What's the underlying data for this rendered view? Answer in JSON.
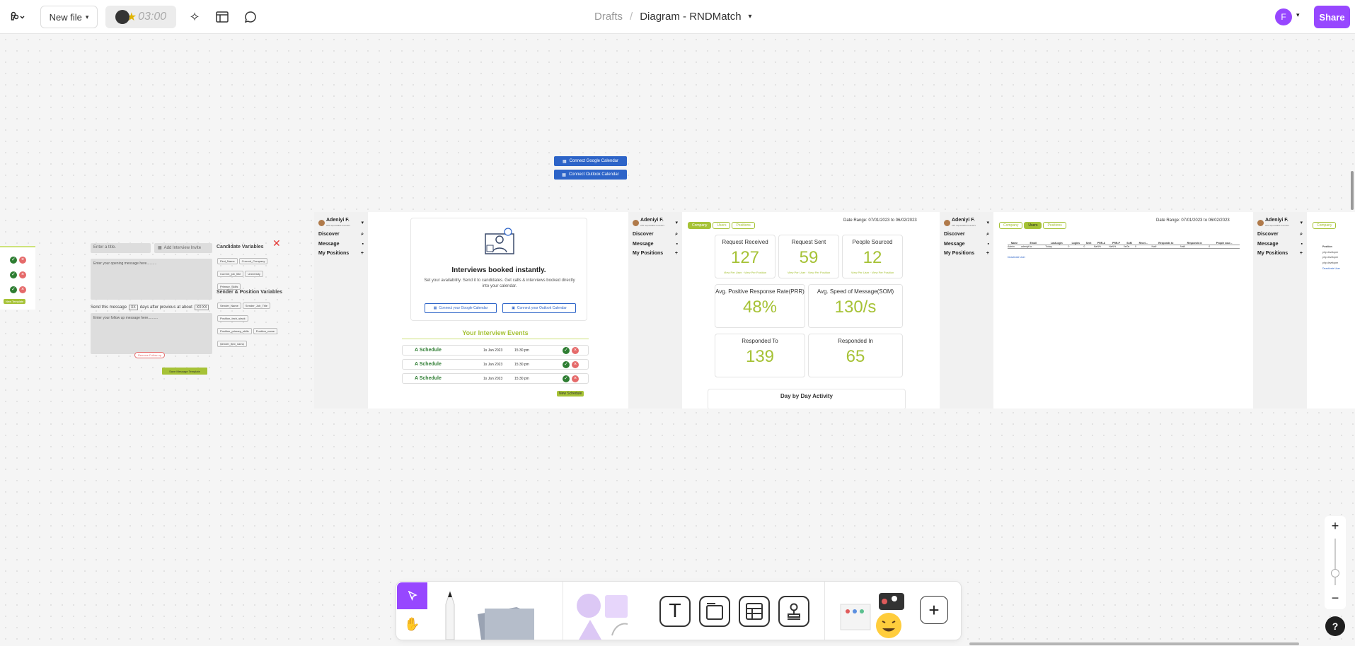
{
  "topbar": {
    "new_file_label": "New file",
    "timer": "03:00",
    "breadcrumb_parent": "Drafts",
    "breadcrumb_sep": "/",
    "file_name": "Diagram - RNDMatch",
    "avatar_initial": "F",
    "share_label": "Share"
  },
  "calendar_buttons": {
    "google": "Connect Google Calendar",
    "outlook": "Connect Outlook Calendar"
  },
  "left_strip": {
    "new_template": "New Template"
  },
  "template_editor": {
    "title_placeholder": "Enter a title.",
    "interview_invite": "Add Interview Invite",
    "opening_placeholder": "Enter your opening message here..........",
    "send_message_prefix": "Send this message",
    "days_value": "XX",
    "days_suffix": "days after previous at about",
    "time_value": "XX:XX",
    "followup_placeholder": "Enter your follow up message here..........",
    "remove_followup": "Remove Follow up",
    "save_template": "Save Message Template",
    "candidate_vars_title": "Candidate Variables",
    "candidate_vars": [
      "First_Name",
      "Current_Company",
      "Current_job_title",
      "University",
      "Primary_Skills"
    ],
    "sender_vars_title": "Sender & Position Variables",
    "sender_vars": [
      "Sender_Name",
      "Sender_Job_Title",
      "Position_tech_stack",
      "Position_primary_skills",
      "Position_name",
      "Sender_first_name"
    ]
  },
  "sidebar": {
    "user_name": "Adeniyi F.",
    "user_sub": "225 requestable founders",
    "items": [
      "Discover",
      "Message",
      "My Positions"
    ]
  },
  "interviews": {
    "headline": "Interviews booked instantly.",
    "subtext": "Set your availability. Send it to candidates. Get calls & interviews booked directly into your calendar.",
    "connect_google": "Connect your Google Calendar",
    "connect_outlook": "Connect your Outlook Calendar",
    "events_title": "Your Interview Events",
    "events": [
      {
        "name": "A Schedule",
        "date": "1s Jan 2023",
        "time": "15:30 pm"
      },
      {
        "name": "A Schedule",
        "date": "1s Jan 2023",
        "time": "15:30 pm"
      },
      {
        "name": "A Schedule",
        "date": "1s Jan 2023",
        "time": "15:30 pm"
      }
    ],
    "new_schedule": "New Schedule"
  },
  "dashboard": {
    "tabs": [
      "Company",
      "Users",
      "Positions"
    ],
    "date_range": "Date Range: 07/01/2023  to  06/02/2023",
    "metrics": [
      {
        "label": "Request Received",
        "value": "127",
        "link_a": "View Per User",
        "link_b": "View Per Position"
      },
      {
        "label": "Request Sent",
        "value": "59",
        "link_a": "View Per User",
        "link_b": "View Per Position"
      },
      {
        "label": "People Sourced",
        "value": "12",
        "link_a": "View Per User",
        "link_b": "View Per Position"
      }
    ],
    "prr_label": "Avg. Positive Response Rate(PRR)",
    "prr_value": "48%",
    "som_label": "Avg. Speed of Message(SOM)",
    "som_value": "130/s",
    "responded_to_label": "Responded To",
    "responded_to_value": "139",
    "responded_in_label": "Responded In",
    "responded_in_value": "65",
    "day_activity": "Day by Day Activity"
  },
  "users_table": {
    "columns": [
      "Name",
      "Email",
      "LastLogin",
      "Logins",
      "Sent",
      "PRR-A",
      "PRR-P",
      "SoM",
      "Recei...",
      "Responds to",
      "Responds in",
      "People sour..."
    ],
    "row": [
      "Admin",
      "adeniyi.fa...",
      "Today",
      "0",
      "0",
      "NaN%",
      "NaN%",
      "0s/0s",
      "0",
      "NaN",
      "NaN",
      "0"
    ],
    "row_sub": "Deactivate User"
  },
  "positions_frame": {
    "rows": [
      "Position",
      "php developer",
      "php developer",
      "php developer"
    ],
    "link": "Deactivate User"
  },
  "zoom": {
    "plus": "+",
    "minus": "−",
    "help": "?"
  }
}
